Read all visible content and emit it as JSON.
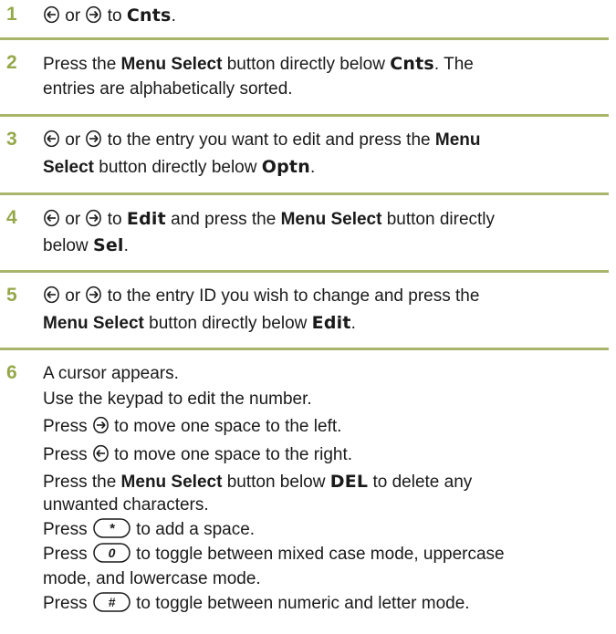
{
  "steps": [
    {
      "number": "1",
      "lines": [
        {
          "a": "or",
          "b": "to",
          "c": "Cnts",
          "d": "."
        }
      ]
    },
    {
      "number": "2",
      "l1": {
        "a": "Press the",
        "b": "Menu Select",
        "c": "button directly below",
        "d": "Cnts",
        "e": ". The"
      },
      "l2": "entries are alphabetically sorted."
    },
    {
      "number": "3",
      "l1": {
        "a": "or",
        "b": "to the entry you want to edit and press the",
        "c": "Menu"
      },
      "l2": {
        "a": "Select",
        "b": "button directly below",
        "c": "Optn",
        "d": "."
      }
    },
    {
      "number": "4",
      "l1": {
        "a": "or",
        "b": "to",
        "c": "Edit",
        "d": "and press the",
        "e": "Menu Select",
        "f": "button directly"
      },
      "l2": {
        "a": "below",
        "b": "Sel",
        "c": "."
      }
    },
    {
      "number": "5",
      "l1": {
        "a": "or",
        "b": "to the entry ID you wish to change and press the"
      },
      "l2": {
        "a": "Menu Select",
        "b": "button directly below",
        "c": "Edit",
        "d": "."
      }
    },
    {
      "number": "6",
      "l1": "A cursor appears.",
      "l2": "Use the keypad to edit the number.",
      "l3": {
        "a": "Press",
        "b": "to move one space to the left."
      },
      "l4": {
        "a": "Press",
        "b": "to move one space to the right."
      },
      "l5": {
        "a": "Press the",
        "b": "Menu Select",
        "c": "button below",
        "d": "DEL",
        "e": "to delete any"
      },
      "l6": "unwanted characters.",
      "l7": {
        "a": "Press",
        "b": "to add a space."
      },
      "l8": {
        "a": "Press",
        "b": "to toggle between mixed case mode, uppercase"
      },
      "l9": "mode, and lowercase mode.",
      "l10": {
        "a": "Press",
        "b": "to toggle between numeric and letter mode."
      }
    }
  ],
  "keys": {
    "star": "*",
    "zero": "0",
    "hash": "#"
  },
  "colors": {
    "step_number": "#94a84a",
    "rule": "#a8b56a",
    "text": "#1a1a1a"
  },
  "icons": [
    "nav-left-icon",
    "nav-right-icon",
    "star-key-icon",
    "zero-key-icon",
    "hash-key-icon"
  ]
}
